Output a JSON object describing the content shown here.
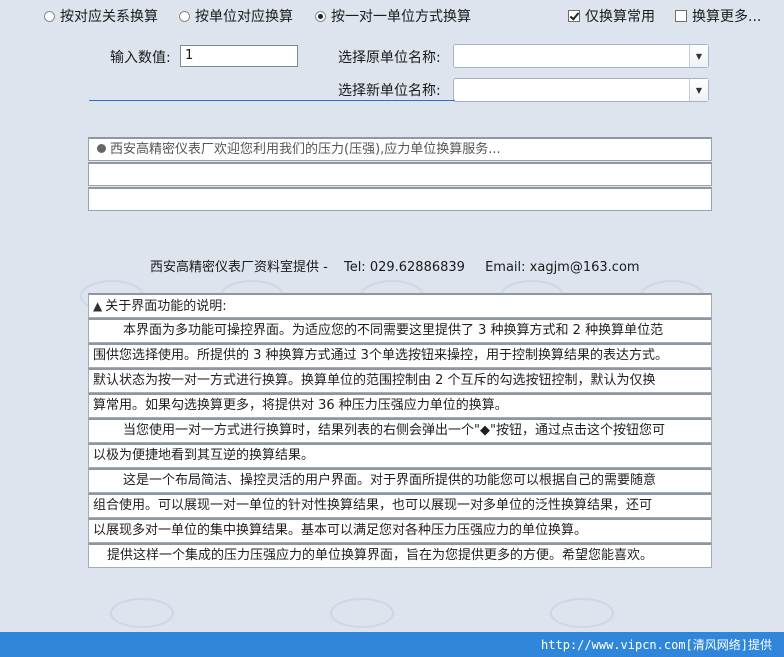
{
  "options": {
    "radio1": "按对应关系换算",
    "radio2": "按单位对应换算",
    "radio3": "按一对一单位方式换算",
    "check1": "仅换算常用",
    "check2": "换算更多..."
  },
  "form": {
    "input_label": "输入数值:",
    "input_value": "1",
    "source_label": "选择原单位名称:",
    "target_label": "选择新单位名称:",
    "source_value": "",
    "target_value": ""
  },
  "results": [
    "西安高精密仪表厂欢迎您利用我们的压力(压强),应力单位换算服务...",
    "",
    ""
  ],
  "credit": {
    "company": "西安高精密仪表厂资料室提供 -",
    "tel": "Tel: 029.62886839",
    "email": "Email: xagjm@163.com"
  },
  "help": {
    "title": "关于界面功能的说明:",
    "lines": [
      "本界面为多功能可操控界面。为适应您的不同需要这里提供了 3 种换算方式和 2 种换算单位范",
      "围供您选择使用。所提供的 3 种换算方式通过 3个单选按钮来操控，用于控制换算结果的表达方式。",
      "默认状态为按一对一方式进行换算。换算单位的范围控制由 2 个互斥的勾选按钮控制，默认为仅换",
      "算常用。如果勾选换算更多，将提供对 36 种压力压强应力单位的换算。",
      "当您使用一对一方式进行换算时，结果列表的右侧会弹出一个\"◆\"按钮，通过点击这个按钮您可",
      "以极为便捷地看到其互逆的换算结果。",
      "这是一个布局简洁、操控灵活的用户界面。对于界面所提供的功能您可以根据自己的需要随意",
      "组合使用。可以展现一对一单位的针对性换算结果，也可以展现一对多单位的泛性换算结果，还可",
      "以展现多对一单位的集中换算结果。基本可以满足您对各种压力压强应力的单位换算。",
      "提供这样一个集成的压力压强应力的单位换算界面，旨在为您提供更多的方便。希望您能喜欢。"
    ]
  },
  "footer": "http://www.vipcn.com[清风网络]提供"
}
